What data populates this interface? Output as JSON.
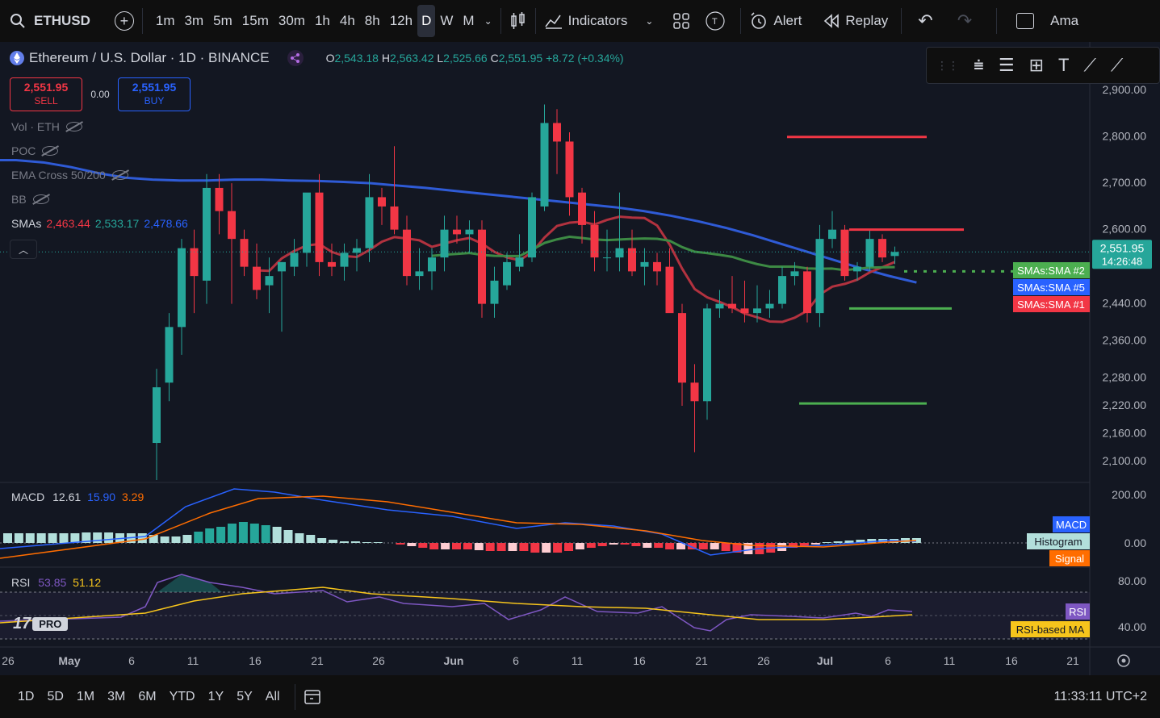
{
  "toolbar": {
    "symbol": "ETHUSD",
    "timeframes": [
      "1m",
      "3m",
      "5m",
      "15m",
      "30m",
      "1h",
      "4h",
      "8h",
      "12h",
      "D",
      "W",
      "M"
    ],
    "active_timeframe": "D",
    "indicators_label": "Indicators",
    "alert_label": "Alert",
    "replay_label": "Replay",
    "account_label": "Ama"
  },
  "legend": {
    "title": "Ethereum / U.S. Dollar · 1D · BINANCE",
    "o_label": "O",
    "o": "2,543.18",
    "h_label": "H",
    "h": "2,563.42",
    "l_label": "L",
    "l": "2,525.66",
    "c_label": "C",
    "c": "2,551.95",
    "change": "+8.72 (+0.34%)",
    "sell_price": "2,551.95",
    "sell_label": "SELL",
    "spread": "0.00",
    "buy_price": "2,551.95",
    "buy_label": "BUY",
    "vol": "Vol · ETH",
    "poc": "POC",
    "ema_cross": "EMA Cross 50/200",
    "bb": "BB",
    "smas_label": "SMAs",
    "sma1": "2,463.44",
    "sma2": "2,533.17",
    "sma3": "2,478.66"
  },
  "price_axis": {
    "ticks": [
      "2,900.00",
      "2,800.00",
      "2,700.00",
      "2,600.00",
      "2,440.00",
      "2,360.00",
      "2,280.00",
      "2,220.00",
      "2,160.00",
      "2,100.00"
    ],
    "current_price": "2,551.95",
    "countdown": "14:26:48",
    "labels": [
      "SMAs:SMA #2",
      "SMAs:SMA #5",
      "SMAs:SMA #1"
    ]
  },
  "macd": {
    "label": "MACD",
    "macd": "12.61",
    "signal_val": "15.90",
    "hist": "3.29",
    "ticks": [
      "200.00",
      "0.00"
    ],
    "labels": [
      "MACD",
      "Histogram",
      "Signal"
    ]
  },
  "rsi": {
    "label": "RSI",
    "rsi": "53.85",
    "ma": "51.12",
    "ticks": [
      "80.00",
      "40.00"
    ],
    "labels": [
      "RSI",
      "RSI-based MA"
    ]
  },
  "logo": "PRO",
  "time_axis": [
    "26",
    "May",
    "6",
    "11",
    "16",
    "21",
    "26",
    "Jun",
    "6",
    "11",
    "16",
    "21",
    "26",
    "Jul",
    "6",
    "11",
    "16",
    "21"
  ],
  "bottom": {
    "ranges": [
      "1D",
      "5D",
      "1M",
      "3M",
      "6M",
      "YTD",
      "1Y",
      "5Y",
      "All"
    ],
    "clock": "11:33:11 UTC+2"
  },
  "colors": {
    "up": "#26a69a",
    "down": "#f23645",
    "sma_blue": "#2f5bd6",
    "sma_red": "#b2323f",
    "sma_green": "#3d8a44"
  },
  "chart_data": {
    "type": "candlestick",
    "title": "Ethereum / U.S. Dollar · 1D · BINANCE",
    "y_range": [
      2060,
      2930
    ],
    "candles": [
      {
        "o": 2140,
        "h": 2300,
        "l": 2060,
        "c": 2260
      },
      {
        "o": 2270,
        "h": 2420,
        "l": 2230,
        "c": 2390
      },
      {
        "o": 2390,
        "h": 2580,
        "l": 2330,
        "c": 2560
      },
      {
        "o": 2560,
        "h": 2600,
        "l": 2420,
        "c": 2500
      },
      {
        "o": 2490,
        "h": 2720,
        "l": 2440,
        "c": 2690
      },
      {
        "o": 2690,
        "h": 2720,
        "l": 2590,
        "c": 2640
      },
      {
        "o": 2640,
        "h": 2700,
        "l": 2440,
        "c": 2580
      },
      {
        "o": 2580,
        "h": 2600,
        "l": 2500,
        "c": 2520
      },
      {
        "o": 2520,
        "h": 2570,
        "l": 2450,
        "c": 2470
      },
      {
        "o": 2480,
        "h": 2540,
        "l": 2420,
        "c": 2500
      },
      {
        "o": 2510,
        "h": 2530,
        "l": 2380,
        "c": 2530
      },
      {
        "o": 2520,
        "h": 2580,
        "l": 2500,
        "c": 2550
      },
      {
        "o": 2550,
        "h": 2600,
        "l": 2520,
        "c": 2680
      },
      {
        "o": 2680,
        "h": 2720,
        "l": 2500,
        "c": 2530
      },
      {
        "o": 2530,
        "h": 2570,
        "l": 2500,
        "c": 2520
      },
      {
        "o": 2520,
        "h": 2570,
        "l": 2490,
        "c": 2550
      },
      {
        "o": 2550,
        "h": 2580,
        "l": 2510,
        "c": 2560
      },
      {
        "o": 2560,
        "h": 2720,
        "l": 2530,
        "c": 2670
      },
      {
        "o": 2670,
        "h": 2690,
        "l": 2610,
        "c": 2650
      },
      {
        "o": 2650,
        "h": 2780,
        "l": 2590,
        "c": 2600
      },
      {
        "o": 2600,
        "h": 2630,
        "l": 2480,
        "c": 2500
      },
      {
        "o": 2500,
        "h": 2560,
        "l": 2470,
        "c": 2510
      },
      {
        "o": 2510,
        "h": 2560,
        "l": 2470,
        "c": 2540
      },
      {
        "o": 2540,
        "h": 2630,
        "l": 2510,
        "c": 2600
      },
      {
        "o": 2600,
        "h": 2630,
        "l": 2570,
        "c": 2590
      },
      {
        "o": 2590,
        "h": 2620,
        "l": 2550,
        "c": 2600
      },
      {
        "o": 2600,
        "h": 2620,
        "l": 2410,
        "c": 2440
      },
      {
        "o": 2440,
        "h": 2520,
        "l": 2410,
        "c": 2490
      },
      {
        "o": 2480,
        "h": 2550,
        "l": 2470,
        "c": 2530
      },
      {
        "o": 2520,
        "h": 2590,
        "l": 2510,
        "c": 2540
      },
      {
        "o": 2540,
        "h": 2680,
        "l": 2530,
        "c": 2670
      },
      {
        "o": 2650,
        "h": 2870,
        "l": 2640,
        "c": 2830
      },
      {
        "o": 2830,
        "h": 2860,
        "l": 2720,
        "c": 2790
      },
      {
        "o": 2790,
        "h": 2810,
        "l": 2630,
        "c": 2670
      },
      {
        "o": 2680,
        "h": 2690,
        "l": 2570,
        "c": 2610
      },
      {
        "o": 2610,
        "h": 2640,
        "l": 2510,
        "c": 2540
      },
      {
        "o": 2540,
        "h": 2600,
        "l": 2510,
        "c": 2540
      },
      {
        "o": 2540,
        "h": 2680,
        "l": 2510,
        "c": 2560
      },
      {
        "o": 2560,
        "h": 2600,
        "l": 2500,
        "c": 2510
      },
      {
        "o": 2520,
        "h": 2560,
        "l": 2480,
        "c": 2530
      },
      {
        "o": 2530,
        "h": 2550,
        "l": 2480,
        "c": 2510
      },
      {
        "o": 2520,
        "h": 2560,
        "l": 2440,
        "c": 2420
      },
      {
        "o": 2420,
        "h": 2440,
        "l": 2220,
        "c": 2270
      },
      {
        "o": 2270,
        "h": 2310,
        "l": 2120,
        "c": 2230
      },
      {
        "o": 2230,
        "h": 2440,
        "l": 2190,
        "c": 2430
      },
      {
        "o": 2430,
        "h": 2470,
        "l": 2410,
        "c": 2440
      },
      {
        "o": 2440,
        "h": 2500,
        "l": 2420,
        "c": 2430
      },
      {
        "o": 2430,
        "h": 2490,
        "l": 2400,
        "c": 2420
      },
      {
        "o": 2420,
        "h": 2480,
        "l": 2400,
        "c": 2430
      },
      {
        "o": 2430,
        "h": 2470,
        "l": 2410,
        "c": 2440
      },
      {
        "o": 2440,
        "h": 2520,
        "l": 2430,
        "c": 2500
      },
      {
        "o": 2500,
        "h": 2530,
        "l": 2480,
        "c": 2510
      },
      {
        "o": 2510,
        "h": 2520,
        "l": 2400,
        "c": 2420
      },
      {
        "o": 2420,
        "h": 2610,
        "l": 2390,
        "c": 2580
      },
      {
        "o": 2580,
        "h": 2640,
        "l": 2560,
        "c": 2600
      },
      {
        "o": 2600,
        "h": 2610,
        "l": 2490,
        "c": 2500
      },
      {
        "o": 2510,
        "h": 2530,
        "l": 2490,
        "c": 2520
      },
      {
        "o": 2520,
        "h": 2600,
        "l": 2510,
        "c": 2580
      },
      {
        "o": 2580,
        "h": 2590,
        "l": 2530,
        "c": 2540
      },
      {
        "o": 2543.18,
        "h": 2563.42,
        "l": 2525.66,
        "c": 2551.95
      }
    ]
  }
}
